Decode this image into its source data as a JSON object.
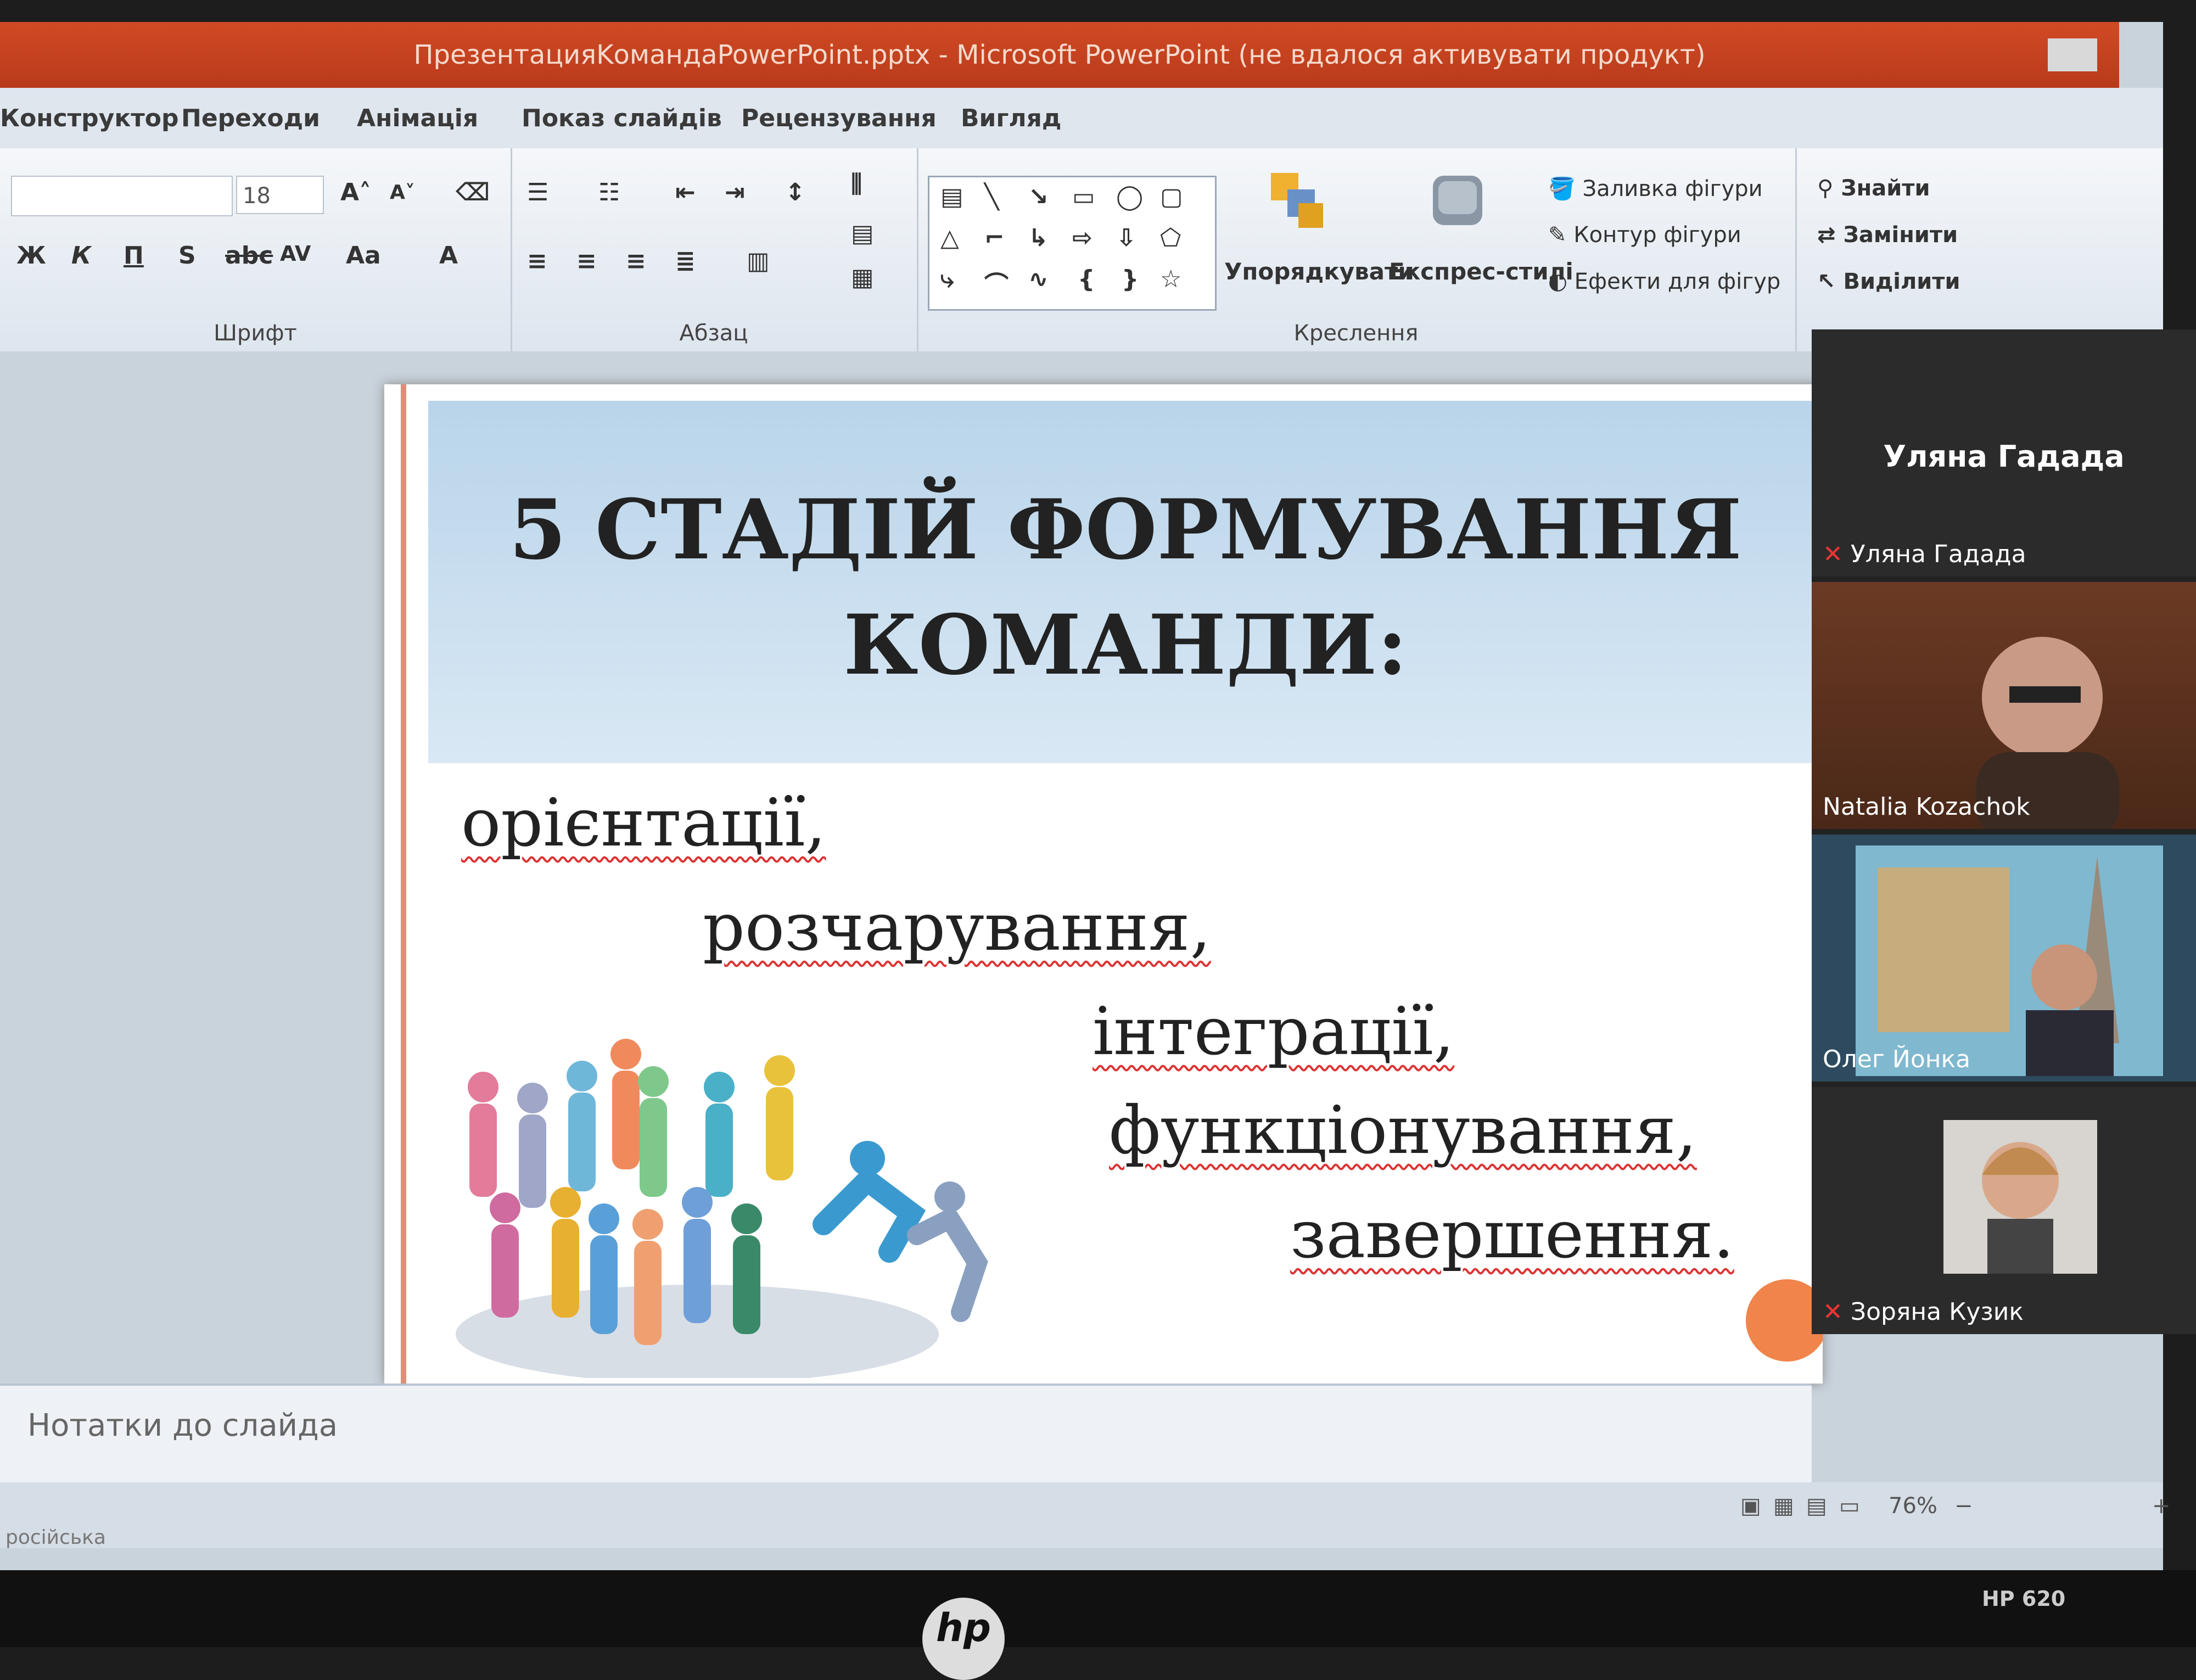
{
  "window": {
    "title": "ПрезентацияKомандаPowerPoint.pptx  -  Microsoft PowerPoint (не вдалося активувати продукт)"
  },
  "tabs": [
    "Конструктор",
    "Переходи",
    "Анімація",
    "Показ слайдів",
    "Рецензування",
    "Вигляд"
  ],
  "ribbon": {
    "font_size": "18",
    "groups": {
      "font": "Шрифт",
      "paragraph": "Абзац",
      "drawing": "Креслення"
    },
    "arrange": "Упорядкувати",
    "quick_styles": "Експрес-стилі",
    "shape_fill": "Заливка фігури",
    "shape_outline": "Контур фігури",
    "shape_effects": "Ефекти для фігур",
    "find": "Знайти",
    "replace": "Замінити",
    "select": "Виділити"
  },
  "slide": {
    "title_line1": "5 СТАДІЙ ФОРМУВАННЯ",
    "title_line2": "КОМАНДИ:",
    "stages": [
      "орієнтації,",
      "розчарування,",
      "інтеграції,",
      "функціонування,",
      "завершення."
    ]
  },
  "notes": {
    "placeholder": "Нотатки до слайда"
  },
  "status": {
    "zoom": "76%",
    "lang": "російська"
  },
  "participants": [
    {
      "name": "Уляна Гадада",
      "big_label": "Уляна Гадада"
    },
    {
      "name": "Natalia Kozachok"
    },
    {
      "name": "Олег Йонка"
    },
    {
      "name": "Зоряна Кузик"
    }
  ],
  "laptop": {
    "brand": "hp",
    "model": "HP 620"
  }
}
